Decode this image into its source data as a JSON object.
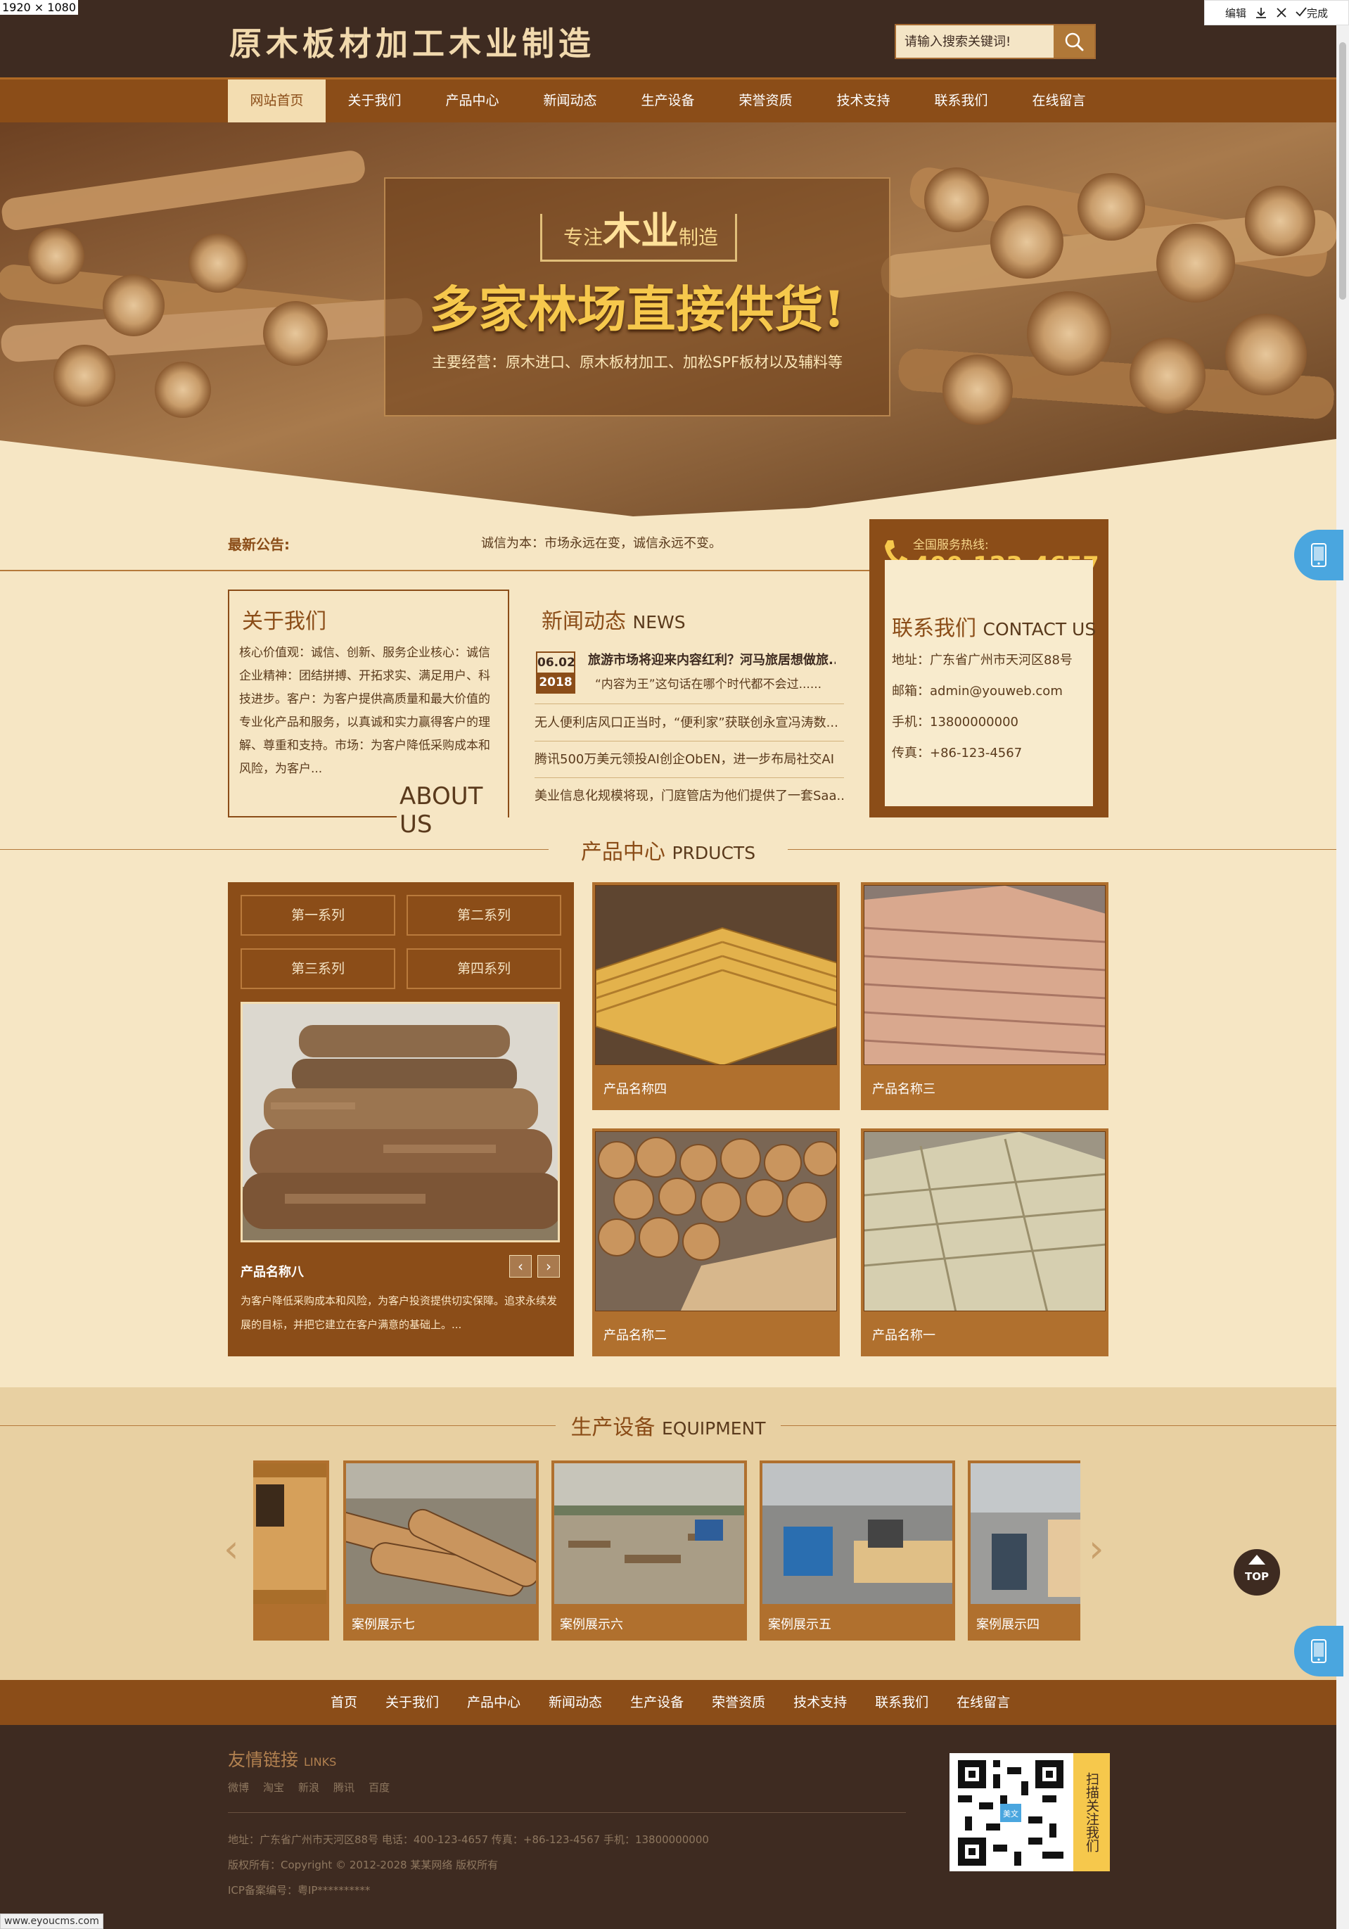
{
  "window": {
    "dimensions": "1920 × 1080",
    "status_url": "www.eyoucms.com"
  },
  "browser_toolbar": {
    "edit": "编辑",
    "done": "完成"
  },
  "header": {
    "logo": "原木板材加工木业制造",
    "search_placeholder": "请输入搜索关键词!"
  },
  "nav": {
    "items": [
      "网站首页",
      "关于我们",
      "产品中心",
      "新闻动态",
      "生产设备",
      "荣誉资质",
      "技术支持",
      "联系我们",
      "在线留言"
    ],
    "active": 0
  },
  "banner": {
    "tag_prefix": "专注",
    "tag_main": "木业",
    "tag_suffix": "制造",
    "slogan": "多家林场直接供货!",
    "subtitle": "主要经营：原木进口、原木板材加工、加松SPF板材以及辅料等"
  },
  "notice": {
    "label": "最新公告:",
    "text": "诚信为本：市场永远在变，诚信永远不变。"
  },
  "about": {
    "title": "关于我们",
    "text": "核心价值观：诚信、创新、服务企业核心：诚信 企业精神：团结拼搏、开拓求实、满足用户、科技进步。客户：为客户提供高质量和最大价值的专业化产品和服务，以真诚和实力赢得客户的理解、尊重和支持。市场：为客户降低采购成本和风险，为客户...",
    "en": "ABOUT US"
  },
  "news": {
    "title": "新闻动态",
    "title_en": "NEWS",
    "first": {
      "day": "06.02",
      "year": "2018",
      "title": "旅游市场将迎来内容红利？河马旅居想做旅...",
      "desc": "“内容为王”这句话在哪个时代都不会过......"
    },
    "items": [
      "无人便利店风口正当时，“便利家”获联创永宣冯涛数...",
      "腾讯500万美元领投AI创企ObEN，进一步布局社交AI",
      "美业信息化规模将现，门庭管店为他们提供了一套Saa..."
    ]
  },
  "contact": {
    "hotline_label": "全国服务热线:",
    "hotline": "400-123-4657",
    "title": "联系我们",
    "title_en": "CONTACT US",
    "address": "地址：广东省广州市天河区88号",
    "email": "邮箱：admin@youweb.com",
    "mobile": "手机：13800000000",
    "fax": "传真：+86-123-4567"
  },
  "products": {
    "title": "产品中心",
    "title_en": "PRDUCTS",
    "series": [
      "第一系列",
      "第二系列",
      "第三系列",
      "第四系列"
    ],
    "featured": {
      "name": "产品名称八",
      "desc": "为客户降低采购成本和风险，为客户投资提供切实保障。追求永续发展的目标，并把它建立在客户满意的基础上。..."
    },
    "arrows": {
      "prev": "‹",
      "next": "›"
    },
    "items": [
      {
        "name": "产品名称四"
      },
      {
        "name": "产品名称三"
      },
      {
        "name": "产品名称二"
      },
      {
        "name": "产品名称一"
      }
    ]
  },
  "equipment": {
    "title": "生产设备",
    "title_en": "EQUIPMENT",
    "arrows": {
      "prev": "‹",
      "next": "›"
    },
    "items": [
      "",
      "案例展示七",
      "案例展示六",
      "案例展示五",
      "案例展示四"
    ]
  },
  "footer_nav": [
    "首页",
    "关于我们",
    "产品中心",
    "新闻动态",
    "生产设备",
    "荣誉资质",
    "技术支持",
    "联系我们",
    "在线留言"
  ],
  "footer": {
    "links_title": "友情链接",
    "links_title_en": "LINKS",
    "links": [
      "微博",
      "淘宝",
      "新浪",
      "腾讯",
      "百度"
    ],
    "address_line": "地址：广东省广州市天河区88号    电话：400-123-4657 传真：+86-123-4567    手机：13800000000",
    "copyright": "版权所有：Copyright © 2012-2028 某某网络 版权所有",
    "icp": "ICP备案编号：粤IP**********",
    "qr_label": "扫描关注我们",
    "qr_badge": "美文"
  },
  "top_button": "TOP",
  "colors": {
    "header": "#3e2b21",
    "nav": "#8b4d18",
    "page_bg": "#f6e6c4",
    "accent": "#f6c84c",
    "phone_float": "#4aa6df"
  }
}
